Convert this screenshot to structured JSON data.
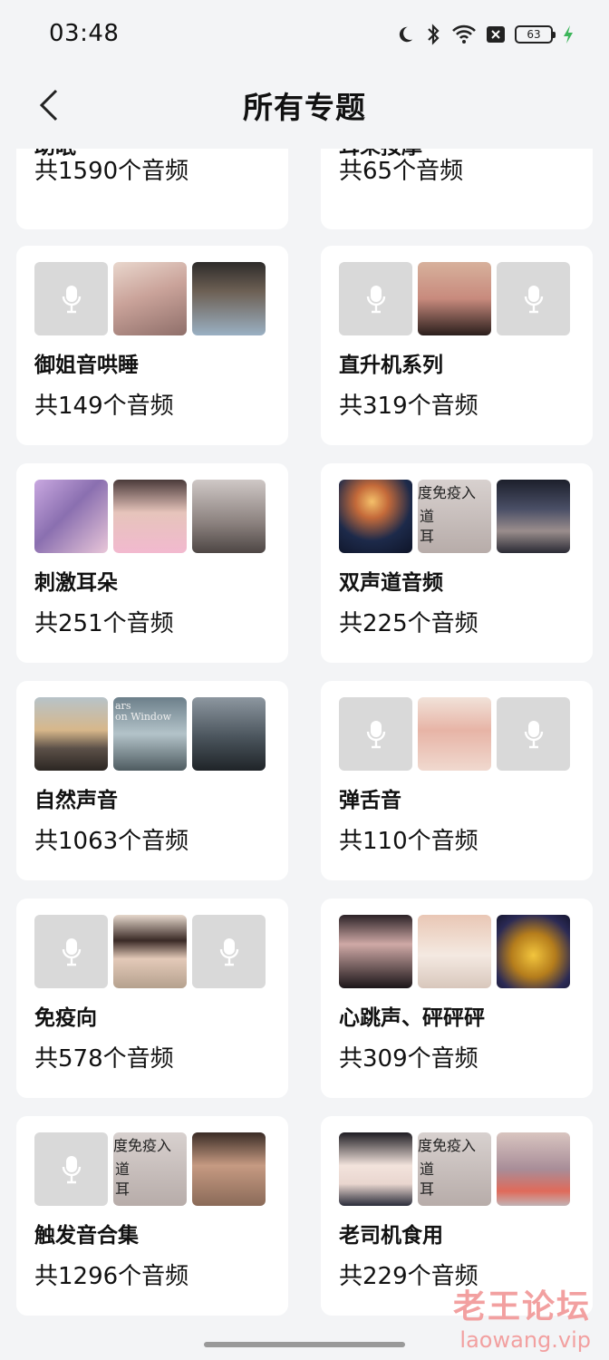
{
  "status_bar": {
    "time": "03:48",
    "battery": "63"
  },
  "header": {
    "title": "所有专题"
  },
  "topics": [
    {
      "name": "助眠",
      "count": "共1590个音频"
    },
    {
      "name": "耳朵按摩",
      "count": "共65个音频"
    },
    {
      "name": "御姐音哄睡",
      "count": "共149个音频"
    },
    {
      "name": "直升机系列",
      "count": "共319个音频"
    },
    {
      "name": "刺激耳朵",
      "count": "共251个音频"
    },
    {
      "name": "双声道音频",
      "count": "共225个音频"
    },
    {
      "name": "自然声音",
      "count": "共1063个音频"
    },
    {
      "name": "弹舌音",
      "count": "共110个音频"
    },
    {
      "name": "免疫向",
      "count": "共578个音频"
    },
    {
      "name": "心跳声、砰砰砰",
      "count": "共309个音频"
    },
    {
      "name": "触发音合集",
      "count": "共1296个音频"
    },
    {
      "name": "老司机食用",
      "count": "共229个音频"
    }
  ],
  "thumb_texts": {
    "immune": "度免疫入",
    "ch": "道",
    "ear": "耳",
    "window_1": "ars",
    "window_2": "on Window"
  },
  "watermark": {
    "name": "老王论坛",
    "url": "laowang.vip"
  }
}
